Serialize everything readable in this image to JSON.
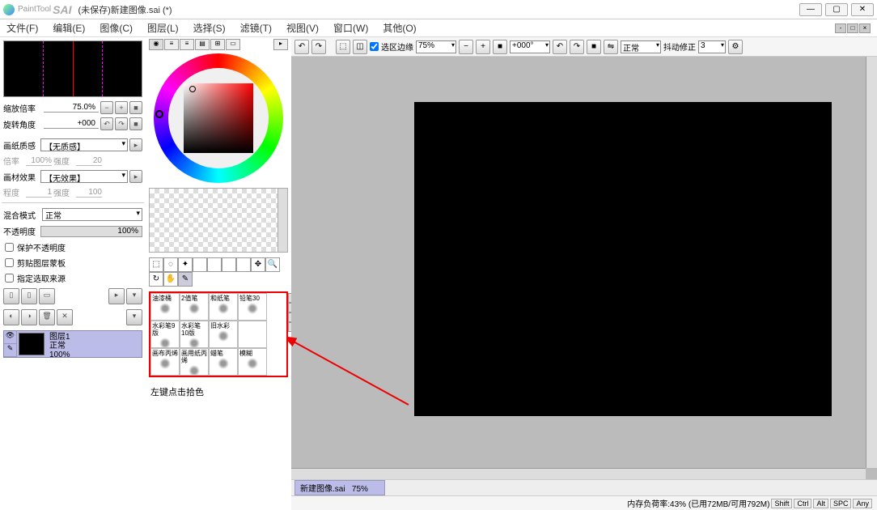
{
  "titlebar": {
    "appname_small": "PaintTool",
    "appname_bold": "SAI",
    "docname": "(未保存)新建图像.sai (*)"
  },
  "menus": [
    "文件(F)",
    "编辑(E)",
    "图像(C)",
    "图层(L)",
    "选择(S)",
    "滤镜(T)",
    "视图(V)",
    "窗口(W)",
    "其他(O)"
  ],
  "nav": {
    "zoom_label": "缩放倍率",
    "zoom_value": "75.0%",
    "rotate_label": "旋转角度",
    "rotate_value": "+000"
  },
  "paper": {
    "quality_label": "画纸质感",
    "quality_value": "【无质感】",
    "scale_label": "倍率",
    "scale_value": "100%",
    "strength_label": "强度",
    "strength_value": "20",
    "effect_label": "画材效果",
    "effect_value": "【无效果】",
    "degree_label": "程度",
    "degree_value": "1",
    "estrength_label": "强度",
    "estrength_value": "100"
  },
  "blend": {
    "mode_label": "混合模式",
    "mode_value": "正常",
    "opacity_label": "不透明度",
    "opacity_value": "100%"
  },
  "checks": {
    "protect": "保护不透明度",
    "clip": "剪贴图层蒙板",
    "source": "指定选取来源"
  },
  "layer": {
    "name": "图层1",
    "mode": "正常",
    "opacity": "100%"
  },
  "brushes": [
    [
      "油漆桶",
      "2值笔",
      "和纸笔",
      "铅笔30"
    ],
    [
      "水彩笔9版",
      "水彩笔10版",
      "旧水彩",
      ""
    ],
    [
      "画布丙烯",
      "画用纸丙烯",
      "蜡笔",
      "模糊"
    ]
  ],
  "hint": "左键点击拾色",
  "canvastb": {
    "selborder": "选区边缘",
    "zoom": "75%",
    "angle": "+000°",
    "mode": "正常",
    "stabilizer_label": "抖动修正",
    "stabilizer_value": "3"
  },
  "dock": {
    "tab": "新建图像.sai",
    "tabzoom": "75%"
  },
  "status": {
    "mem": "内存负荷率:43% (已用72MB/可用792M)",
    "keys": [
      "Shift",
      "Ctrl",
      "Alt",
      "SPC",
      "Any"
    ]
  }
}
